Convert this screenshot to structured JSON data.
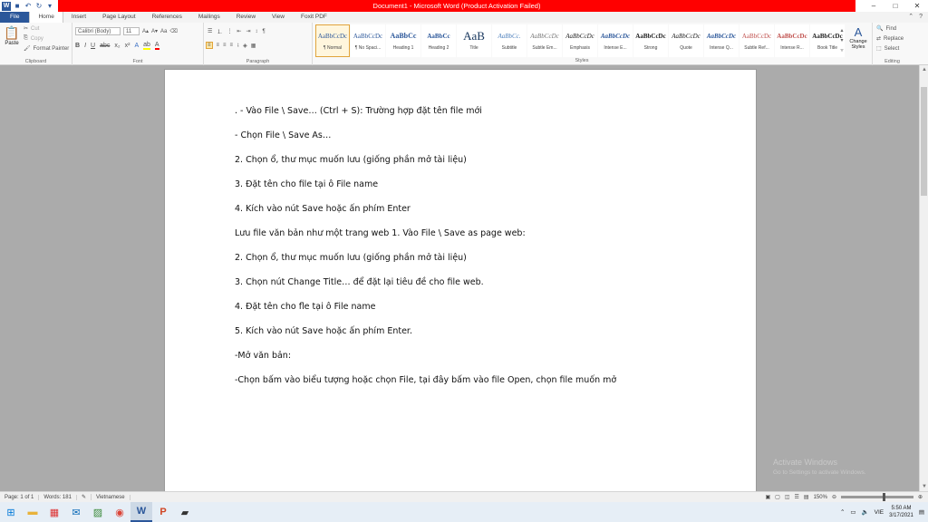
{
  "window": {
    "title": "Document1 - Microsoft Word (Product Activation Failed)",
    "controls": [
      "–",
      "□",
      "✕"
    ]
  },
  "tabs": [
    {
      "label": "File"
    },
    {
      "label": "Home"
    },
    {
      "label": "Insert"
    },
    {
      "label": "Page Layout"
    },
    {
      "label": "References"
    },
    {
      "label": "Mailings"
    },
    {
      "label": "Review"
    },
    {
      "label": "View"
    },
    {
      "label": "Foxit PDF"
    }
  ],
  "ribbon": {
    "clipboard": {
      "paste": "Paste",
      "cut": "Cut",
      "copy": "Copy",
      "format_painter": "Format Painter",
      "label": "Clipboard"
    },
    "font": {
      "name": "Calibri (Body)",
      "size": "11",
      "label": "Font"
    },
    "paragraph": {
      "label": "Paragraph"
    },
    "styles": {
      "label": "Styles",
      "items": [
        {
          "sample": "AaBbCcDc",
          "name": "¶ Normal"
        },
        {
          "sample": "AaBbCcDc",
          "name": "¶ No Spaci..."
        },
        {
          "sample": "AaBbCc",
          "name": "Heading 1"
        },
        {
          "sample": "AaBbCc",
          "name": "Heading 2"
        },
        {
          "sample": "AaB",
          "name": "Title"
        },
        {
          "sample": "AaBbCc.",
          "name": "Subtitle"
        },
        {
          "sample": "AaBbCcDc",
          "name": "Subtle Em..."
        },
        {
          "sample": "AaBbCcDc",
          "name": "Emphasis"
        },
        {
          "sample": "AaBbCcDc",
          "name": "Intense E..."
        },
        {
          "sample": "AaBbCcDc",
          "name": "Strong"
        },
        {
          "sample": "AaBbCcDc",
          "name": "Quote"
        },
        {
          "sample": "AaBbCcDc",
          "name": "Intense Q..."
        },
        {
          "sample": "AaBbCcDc",
          "name": "Subtle Ref..."
        },
        {
          "sample": "AaBbCcDc",
          "name": "Intense R..."
        },
        {
          "sample": "AaBbCcDc",
          "name": "Book Title"
        }
      ],
      "change_styles": "Change Styles"
    },
    "editing": {
      "find": "Find",
      "replace": "Replace",
      "select": "Select",
      "label": "Editing"
    }
  },
  "document": {
    "lines": [
      ". - Vào File \\ Save… (Ctrl + S): Trường hợp đặt tên file mới",
      "- Chọn File \\ Save As…",
      " 2. Chọn ổ, thư mục muốn lưu (giống phần mở tài liệu)",
      " 3. Đặt tên cho file tại ô File name",
      " 4. Kích vào nút Save hoặc ấn phím Enter",
      "Lưu file văn bản như một trang web 1. Vào File \\ Save as page web:",
      "2. Chọn ổ, thư mục muốn lưu (giống phần mở tài liệu)",
      "3. Chọn nút Change Title… để đặt lại tiêu đề cho file web.",
      "4. Đặt tên cho fle tại ô File name",
      " 5. Kích vào nút Save hoặc ấn phím Enter.",
      "-Mở văn bản:",
      "-Chọn bấm vào biểu tượng hoặc chọn File, tại đây bấm vào file Open, chọn file muốn mở"
    ]
  },
  "watermark": {
    "title": "Activate Windows",
    "subtitle": "Go to Settings to activate Windows."
  },
  "status": {
    "page": "Page: 1 of 1",
    "words": "Words: 181",
    "language": "Vietnamese",
    "zoom": "150%"
  },
  "taskbar": {
    "clock_time": "5:50 AM",
    "clock_date": "3/17/2021",
    "lang": "VIE",
    "apps": [
      "windows-start",
      "file-explorer",
      "calendar",
      "mail",
      "photos",
      "chrome",
      "word",
      "powerpoint",
      "sticky"
    ]
  }
}
